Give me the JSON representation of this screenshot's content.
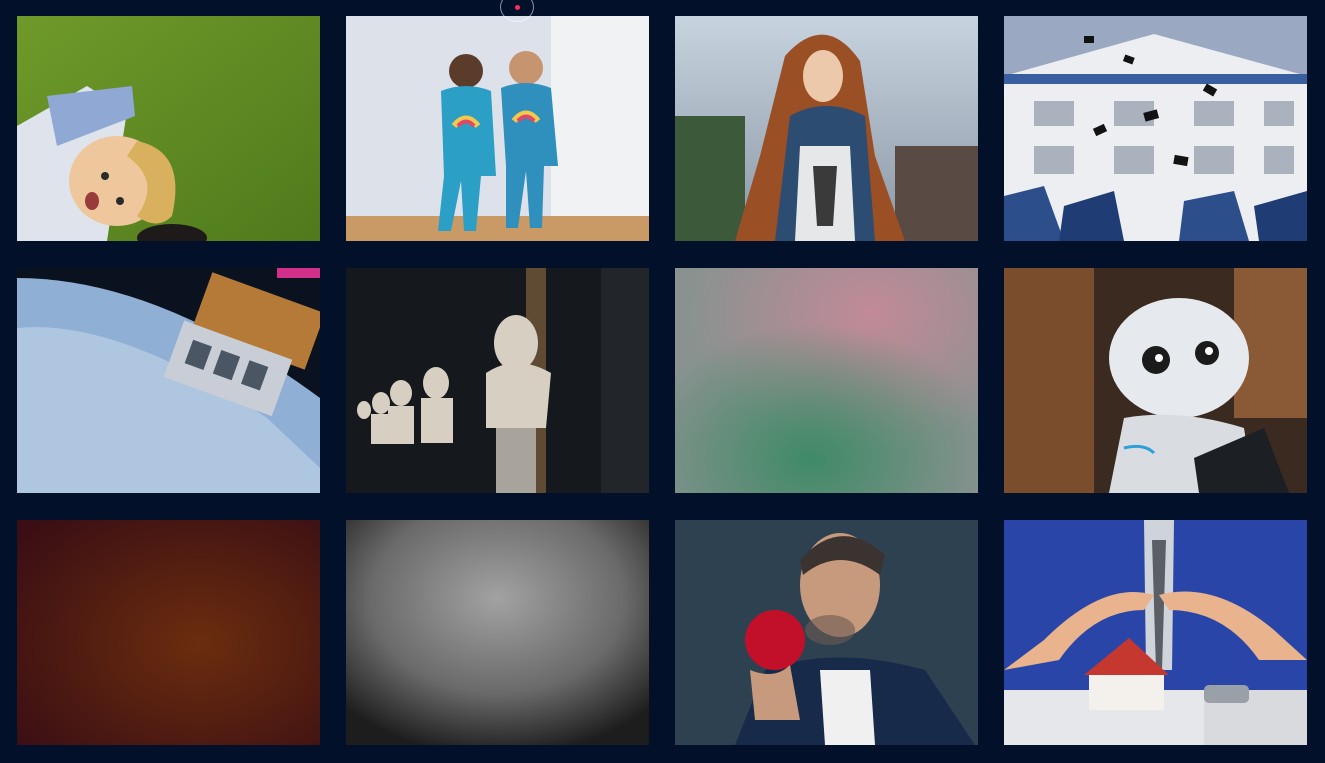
{
  "page": {
    "background": "#03102a",
    "accent": "#ff2d55"
  },
  "tiles": [
    {
      "name": "boy-on-grass-photo",
      "palette": [
        "#5f8a22",
        "#86b33b",
        "#e9c48f",
        "#9ab1d6"
      ]
    },
    {
      "name": "toddlers-rainbow-pajamas-photo",
      "palette": [
        "#dfe3ea",
        "#2b9fc6",
        "#f2c94c",
        "#b98a59"
      ]
    },
    {
      "name": "redhead-woman-horse-photo",
      "palette": [
        "#b8c6d6",
        "#a25a2c",
        "#2d4c72",
        "#cfd2d4"
      ]
    },
    {
      "name": "graduation-caps-building-photo",
      "palette": [
        "#9aa8c2",
        "#eef0f2",
        "#141414",
        "#2c4f8c"
      ]
    },
    {
      "name": "satellite-over-earth-photo",
      "palette": [
        "#0a1220",
        "#8fb0d4",
        "#e6edf5",
        "#b57a37"
      ]
    },
    {
      "name": "library-busts-photo",
      "palette": [
        "#121417",
        "#2a2e33",
        "#d8d2c6",
        "#a97c4a"
      ]
    },
    {
      "name": "blurred-pink-green-photo",
      "palette": [
        "#7a8a84",
        "#b97f8e",
        "#3f8a66",
        "#bfbfbf"
      ]
    },
    {
      "name": "humanoid-robot-photo",
      "palette": [
        "#3a2a20",
        "#7a4d2c",
        "#e7eaee",
        "#2f9fd8"
      ]
    },
    {
      "name": "blurred-maroon-photo",
      "palette": [
        "#3a0e12",
        "#6b2d0e",
        "#521a24",
        "#2a0a0c"
      ]
    },
    {
      "name": "blurred-gray-photo",
      "palette": [
        "#1a1a1a",
        "#9b9b9b",
        "#5a5a5a",
        "#2a2a2a"
      ]
    },
    {
      "name": "man-holding-apple-photo",
      "palette": [
        "#2e4150",
        "#c2102a",
        "#172a4a",
        "#f0f0f0"
      ]
    },
    {
      "name": "house-insurance-hands-photo",
      "palette": [
        "#2a45a8",
        "#e9b38e",
        "#e6e7ea",
        "#c5382f"
      ]
    }
  ]
}
